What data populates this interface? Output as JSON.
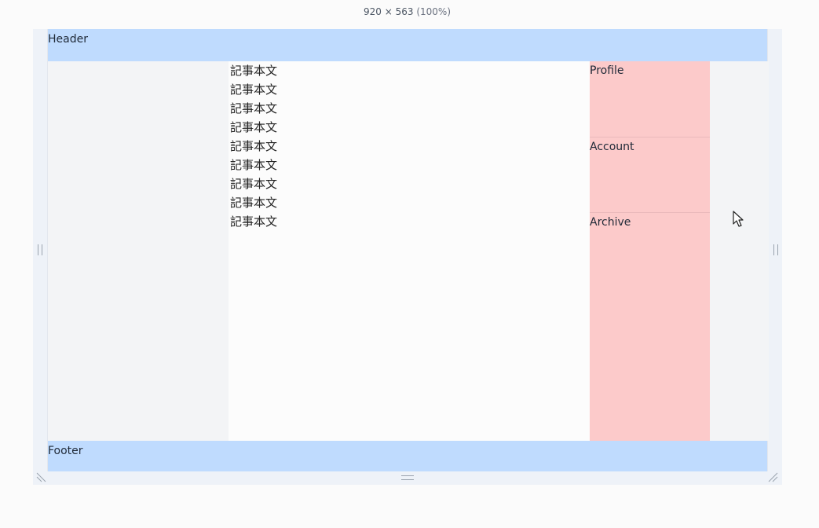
{
  "toolbar": {
    "dimensions": "920 × 563",
    "zoom": "(100%)"
  },
  "page": {
    "header_label": "Header",
    "footer_label": "Footer",
    "article_lines": [
      "記事本文",
      "記事本文",
      "記事本文",
      "記事本文",
      "記事本文",
      "記事本文",
      "記事本文",
      "記事本文",
      "記事本文"
    ],
    "nav_items": [
      "Profile",
      "Account",
      "Archive"
    ]
  },
  "colors": {
    "header_footer_bg": "#bfdbfe",
    "nav_bg": "#fccaca",
    "aside_bg": "#f3f4f6",
    "main_bg": "#fcfcfc"
  },
  "icons": [
    "resize-handle-left-icon",
    "resize-handle-right-icon",
    "resize-handle-bottom-icon",
    "resize-corner-bottom-left-icon",
    "resize-corner-bottom-right-icon",
    "mouse-cursor-icon"
  ]
}
